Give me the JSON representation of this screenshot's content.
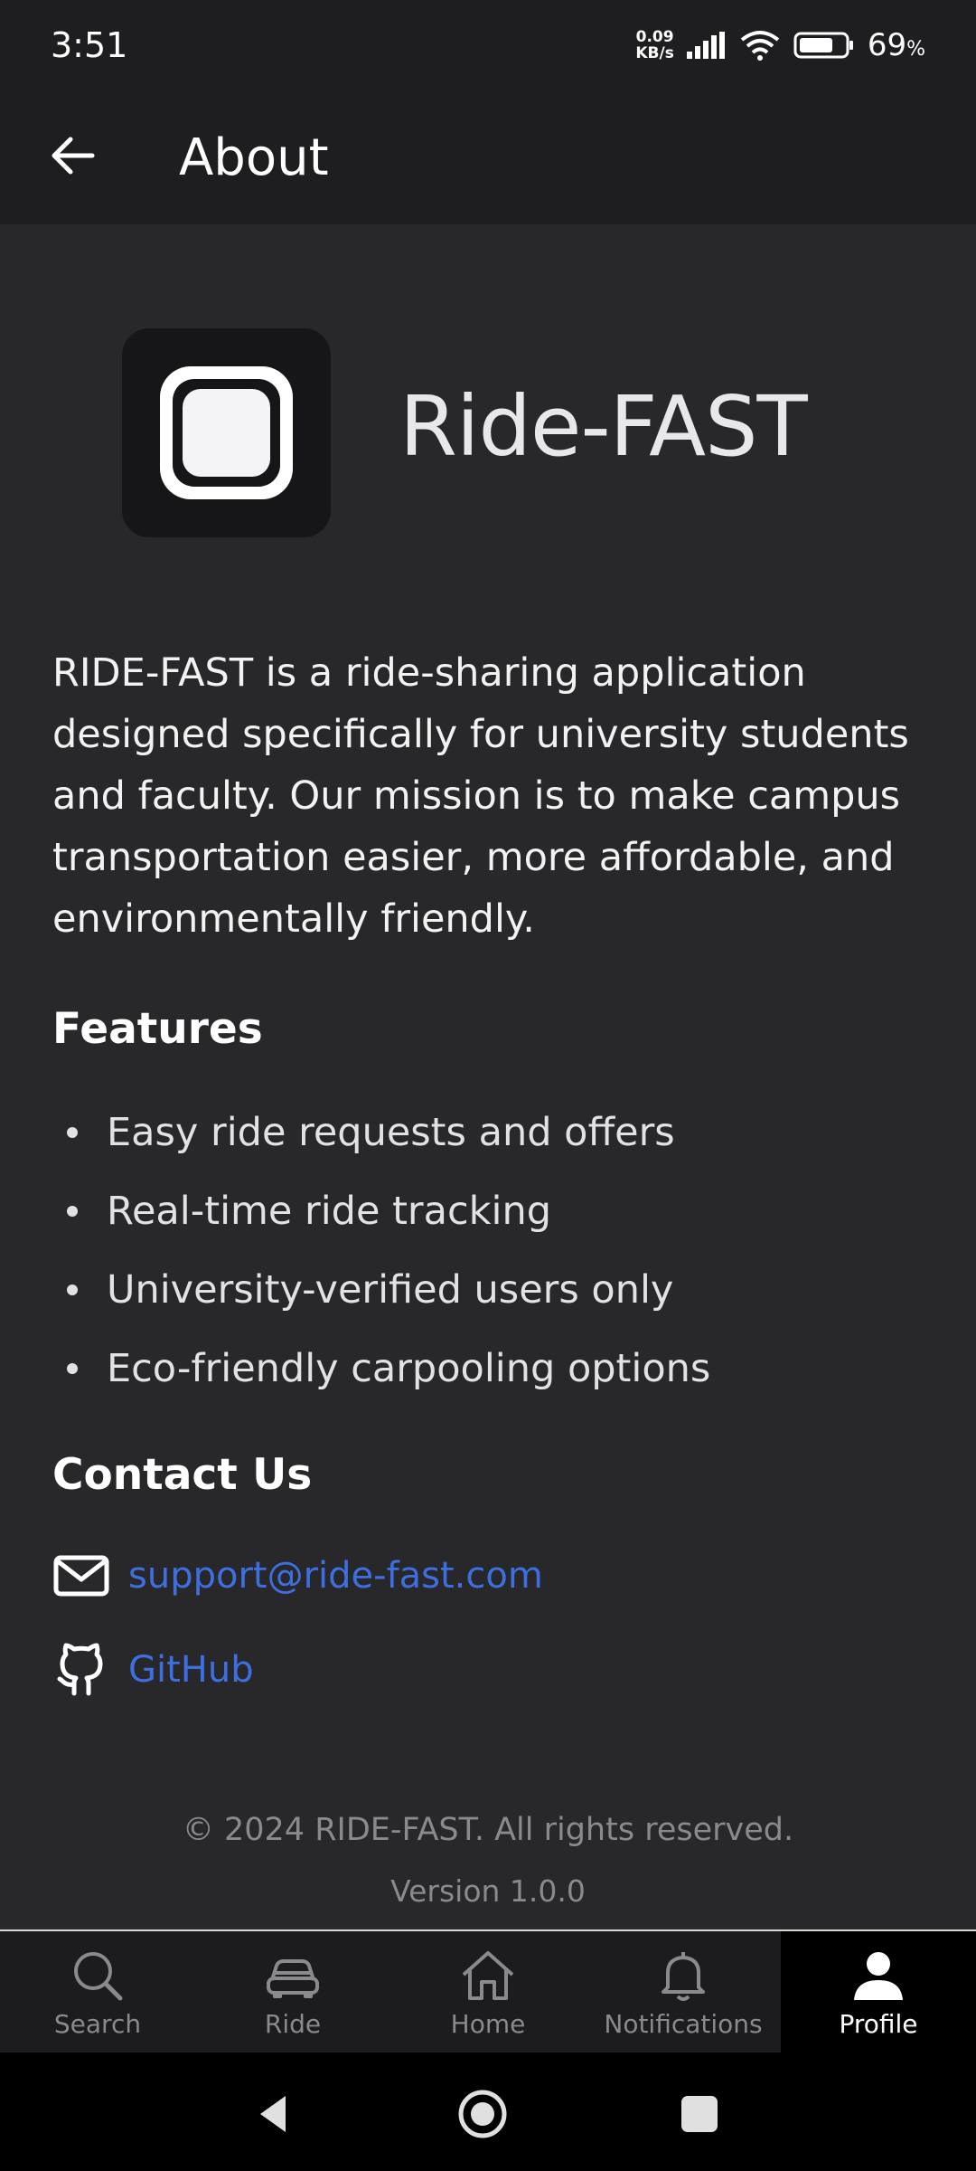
{
  "status_bar": {
    "time": "3:51",
    "net_speed_value": "0.09",
    "net_speed_unit": "KB/s",
    "battery_percent": "69",
    "battery_unit": "%"
  },
  "app_bar": {
    "title": "About",
    "back_icon": "arrow-left-icon"
  },
  "app": {
    "name": "Ride-FAST",
    "logo_icon": "ride-fast-logo",
    "description": "RIDE-FAST is a ride-sharing application designed specifically for university students and faculty. Our mission is to make campus transportation easier, more affordable, and environmentally friendly."
  },
  "features": {
    "title": "Features",
    "items": [
      "Easy ride requests and offers",
      "Real-time ride tracking",
      "University-verified users only",
      "Eco-friendly carpooling options"
    ]
  },
  "contact": {
    "title": "Contact Us",
    "email": "support@ride-fast.com",
    "email_icon": "mail-icon",
    "github": "GitHub",
    "github_icon": "github-icon"
  },
  "footer": {
    "copyright": "© 2024 RIDE-FAST. All rights reserved.",
    "version": "Version 1.0.0"
  },
  "bottom_nav": {
    "items": [
      {
        "label": "Search",
        "icon": "search-icon",
        "active": false
      },
      {
        "label": "Ride",
        "icon": "car-icon",
        "active": false
      },
      {
        "label": "Home",
        "icon": "home-icon",
        "active": false
      },
      {
        "label": "Notifications",
        "icon": "bell-icon",
        "active": false
      },
      {
        "label": "Profile",
        "icon": "person-icon",
        "active": true
      }
    ]
  },
  "colors": {
    "background": "#28282b",
    "app_bar": "#1e1e20",
    "link": "#3d6fe0",
    "muted": "#8a8a8e"
  }
}
